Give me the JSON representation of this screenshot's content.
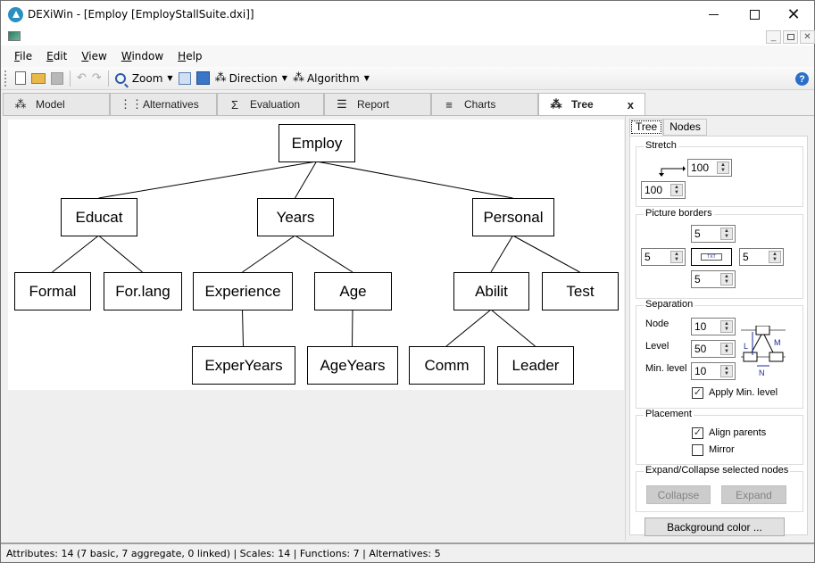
{
  "window": {
    "title": "DEXiWin - [Employ [EmployStallSuite.dxi]]",
    "controls": {
      "minimize": "—",
      "maximize": "☐",
      "close": "✕"
    },
    "mdi_controls": {
      "minimize": "_",
      "restore": "🗗",
      "close": "✕"
    }
  },
  "menu": [
    {
      "label": "File",
      "accel": "F",
      "rest": "ile"
    },
    {
      "label": "Edit",
      "accel": "E",
      "rest": "dit"
    },
    {
      "label": "View",
      "accel": "V",
      "rest": "iew"
    },
    {
      "label": "Window",
      "accel": "W",
      "rest": "indow"
    },
    {
      "label": "Help",
      "accel": "H",
      "rest": "elp"
    }
  ],
  "toolbar": {
    "zoom_label": "Zoom",
    "direction_label": "Direction",
    "algorithm_label": "Algorithm",
    "undo_glyph": "↶",
    "redo_glyph": "↷",
    "help_glyph": "?"
  },
  "tabs": [
    {
      "label": "Model",
      "icon": "⁂"
    },
    {
      "label": "Alternatives",
      "icon": "⋮⋮"
    },
    {
      "label": "Evaluation",
      "icon": "Σ"
    },
    {
      "label": "Report",
      "icon": "☰"
    },
    {
      "label": "Charts",
      "icon": "≡"
    },
    {
      "label": "Tree",
      "icon": "⁂",
      "active": true,
      "close": "x"
    }
  ],
  "tree": {
    "nodes": [
      {
        "id": "employ",
        "label": "Employ",
        "parent": null
      },
      {
        "id": "educat",
        "label": "Educat",
        "parent": "employ"
      },
      {
        "id": "years",
        "label": "Years",
        "parent": "employ"
      },
      {
        "id": "personal",
        "label": "Personal",
        "parent": "employ"
      },
      {
        "id": "formal",
        "label": "Formal",
        "parent": "educat"
      },
      {
        "id": "forlang",
        "label": "For.lang",
        "parent": "educat"
      },
      {
        "id": "experience",
        "label": "Experience",
        "parent": "years"
      },
      {
        "id": "age",
        "label": "Age",
        "parent": "years"
      },
      {
        "id": "abilit",
        "label": "Abilit",
        "parent": "personal"
      },
      {
        "id": "test",
        "label": "Test",
        "parent": "personal"
      },
      {
        "id": "experyears",
        "label": "ExperYears",
        "parent": "experience"
      },
      {
        "id": "ageyears",
        "label": "AgeYears",
        "parent": "age"
      },
      {
        "id": "comm",
        "label": "Comm",
        "parent": "abilit"
      },
      {
        "id": "leader",
        "label": "Leader",
        "parent": "abilit"
      }
    ]
  },
  "side_panel": {
    "tabs": [
      "Tree",
      "Nodes"
    ],
    "stretch": {
      "title": "Stretch",
      "horizontal": "100",
      "vertical": "100"
    },
    "picture_borders": {
      "title": "Picture borders",
      "top": "5",
      "left": "5",
      "right": "5",
      "bottom": "5",
      "diagram_text": "TXT"
    },
    "separation": {
      "title": "Separation",
      "node_label": "Node",
      "node_value": "10",
      "level_label": "Level",
      "level_value": "50",
      "min_level_label": "Min. level",
      "min_level_value": "10",
      "apply_min_level_label": "Apply Min. level",
      "apply_min_level_checked": true,
      "diagram_labels": {
        "L": "L",
        "M": "M",
        "N": "N"
      }
    },
    "placement": {
      "title": "Placement",
      "align_parents_label": "Align parents",
      "align_parents_checked": true,
      "mirror_label": "Mirror",
      "mirror_checked": false
    },
    "expand_collapse": {
      "title": "Expand/Collapse selected nodes",
      "collapse_label": "Collapse",
      "expand_label": "Expand"
    },
    "background_color_label": "Background color ..."
  },
  "status_bar": {
    "text": "Attributes: 14 (7 basic, 7 aggregate, 0 linked)  |  Scales: 14  |  Functions: 7  |  Alternatives: 5"
  }
}
